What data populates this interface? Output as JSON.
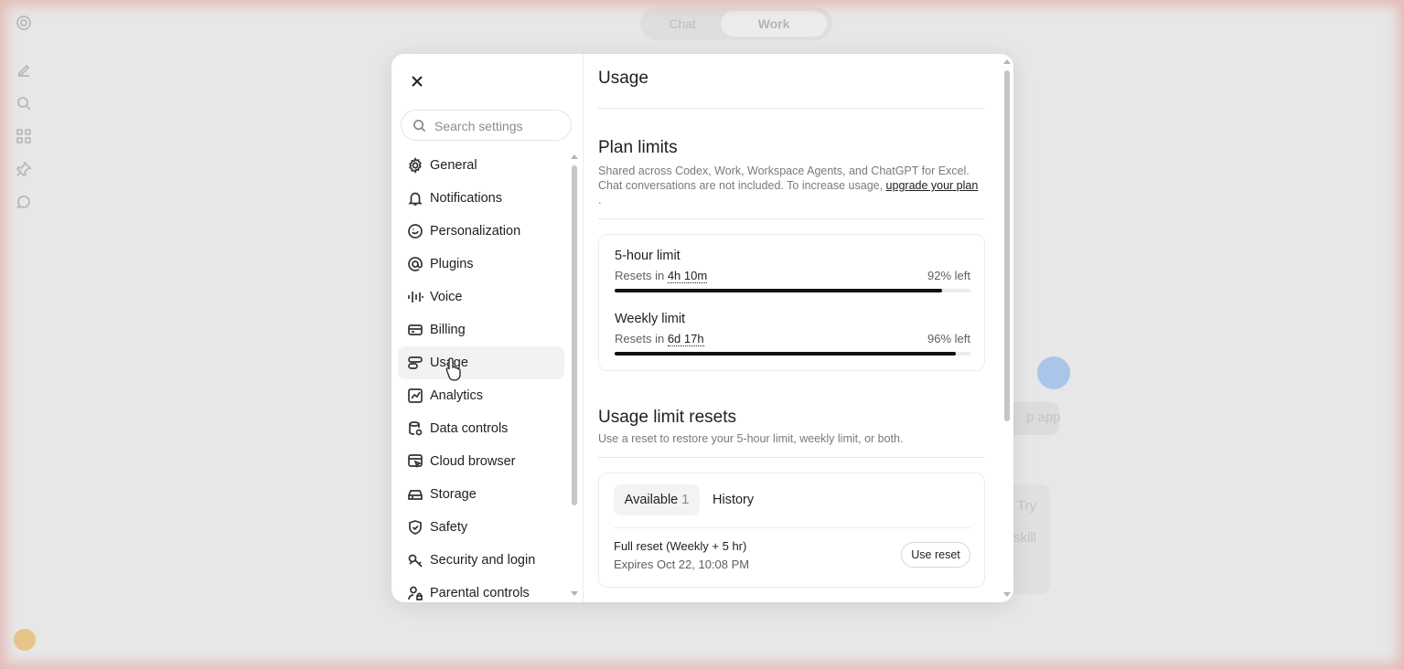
{
  "background": {
    "tabs": [
      {
        "label": "Chat"
      },
      {
        "label": "Work"
      }
    ],
    "ghost_texts": [
      "Try",
      "skill",
      "p app"
    ]
  },
  "settings": {
    "search": {
      "placeholder": "Search settings"
    },
    "nav": [
      {
        "label": "General",
        "icon": "gear-icon"
      },
      {
        "label": "Notifications",
        "icon": "bell-icon"
      },
      {
        "label": "Personalization",
        "icon": "personalization-icon"
      },
      {
        "label": "Plugins",
        "icon": "at-sign-icon"
      },
      {
        "label": "Voice",
        "icon": "waveform-icon"
      },
      {
        "label": "Billing",
        "icon": "credit-card-icon"
      },
      {
        "label": "Usage",
        "icon": "usage-icon",
        "active": true
      },
      {
        "label": "Analytics",
        "icon": "chart-icon"
      },
      {
        "label": "Data controls",
        "icon": "database-icon"
      },
      {
        "label": "Cloud browser",
        "icon": "browser-cursor-icon"
      },
      {
        "label": "Storage",
        "icon": "drive-icon"
      },
      {
        "label": "Safety",
        "icon": "shield-check-icon"
      },
      {
        "label": "Security and login",
        "icon": "key-icon"
      },
      {
        "label": "Parental controls",
        "icon": "user-lock-icon"
      }
    ]
  },
  "usage": {
    "title": "Usage",
    "plan_limits": {
      "title": "Plan limits",
      "desc_text": "Shared across Codex, Work, Workspace Agents, and ChatGPT for Excel. Chat conversations are not included. To increase usage, ",
      "desc_link": "upgrade your plan",
      "desc_end": "."
    },
    "limits": [
      {
        "name": "5-hour limit",
        "resets_prefix": "Resets in",
        "resets_in": "4h 10m",
        "left_text": "92% left",
        "fraction": 0.92
      },
      {
        "name": "Weekly limit",
        "resets_prefix": "Resets in",
        "resets_in": "6d 17h",
        "left_text": "96% left",
        "fraction": 0.96
      }
    ],
    "resets": {
      "title": "Usage limit resets",
      "desc": "Use a reset to restore your 5-hour limit, weekly limit, or both.",
      "tab_available": "Available",
      "tab_available_count": "1",
      "tab_history": "History",
      "item_title": "Full reset (Weekly + 5 hr)",
      "item_expires": "Expires Oct 22, 10:08 PM",
      "use_button": "Use reset"
    }
  }
}
